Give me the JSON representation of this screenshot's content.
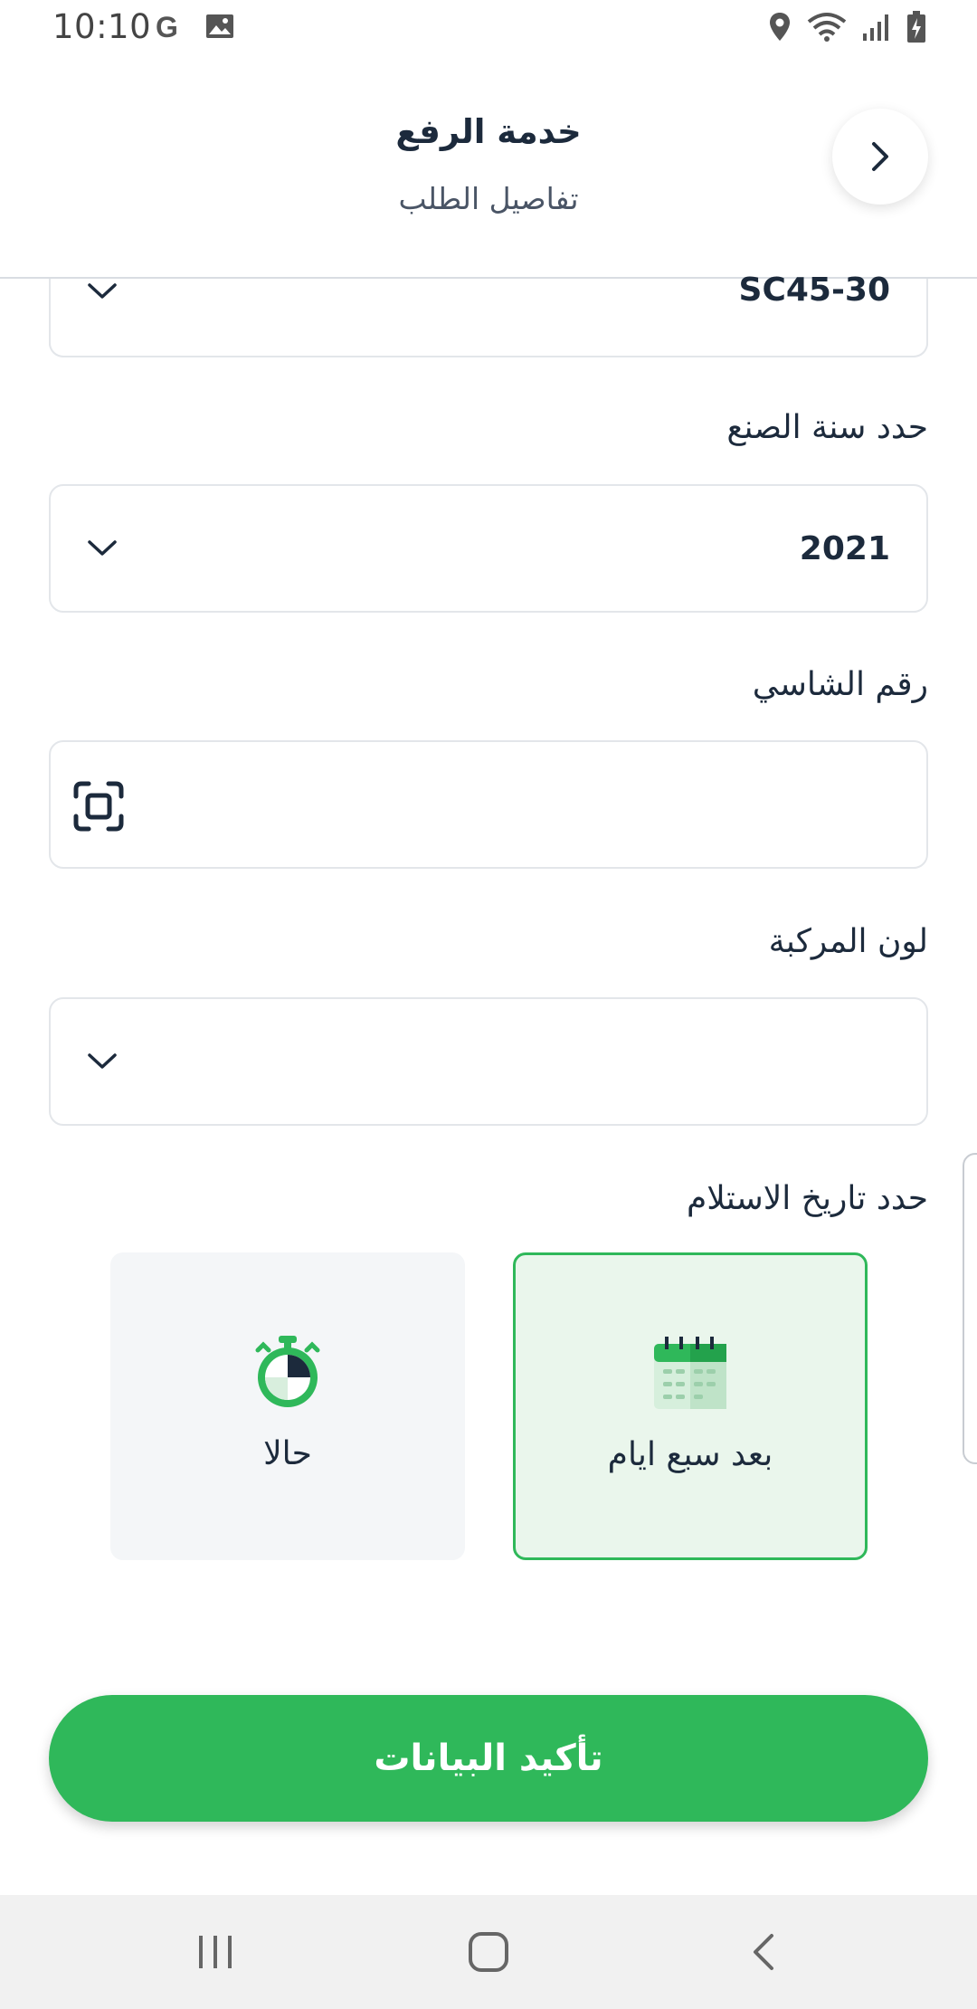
{
  "status_bar": {
    "time": "10:10",
    "left_icons": [
      "google-icon",
      "image-icon"
    ],
    "right_icons": [
      "location-icon",
      "wifi-icon",
      "signal-icon",
      "battery-charging-icon"
    ]
  },
  "header": {
    "title": "خدمة الرفع",
    "subtitle": "تفاصيل الطلب",
    "back_icon": "chevron-right-icon"
  },
  "form": {
    "model_value": "SC45-30",
    "year_label": "حدد سنة الصنع",
    "year_value": "2021",
    "chassis_label": "رقم الشاسي",
    "chassis_value": "",
    "color_label": "لون المركبة",
    "color_value": "",
    "delivery_label": "حدد تاريخ الاستلام"
  },
  "delivery_options": [
    {
      "label": "حالا",
      "icon": "stopwatch-icon",
      "selected": false
    },
    {
      "label": "بعد سبع ايام",
      "icon": "calendar-icon",
      "selected": true
    }
  ],
  "confirm_button": "تأكيد البيانات",
  "colors": {
    "accent": "#2fb85a",
    "selected_bg": "#eaf6ec",
    "text_dark": "#1c2a3c"
  },
  "nav_bar": [
    "recent-apps-icon",
    "home-icon",
    "back-icon"
  ]
}
